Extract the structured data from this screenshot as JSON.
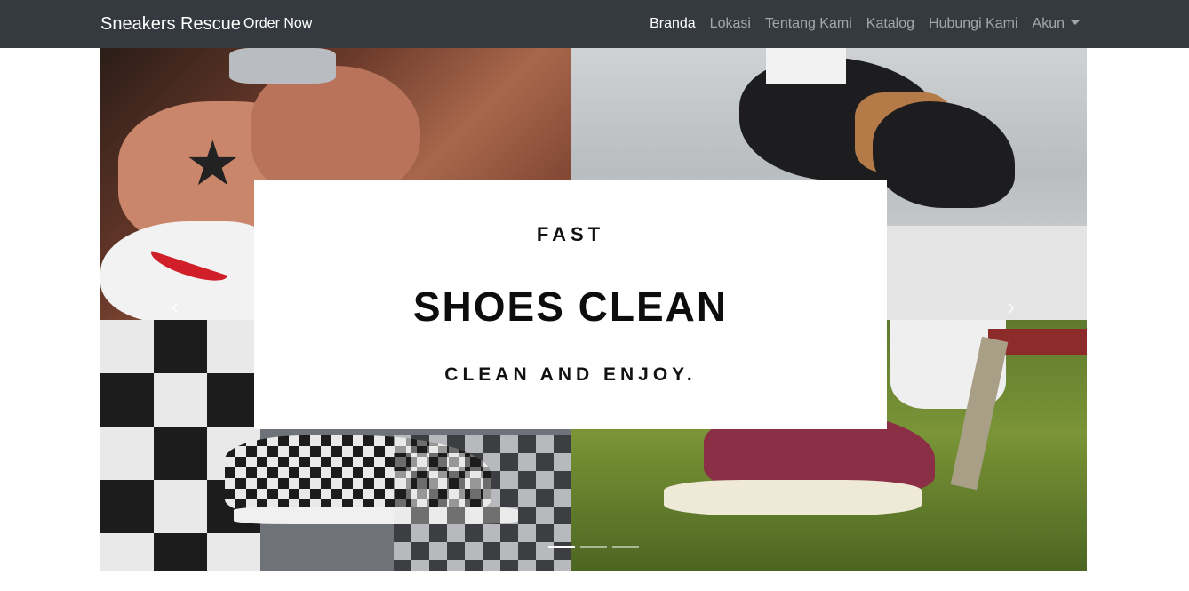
{
  "navbar": {
    "brand": "Sneakers Rescue",
    "order_now": "Order Now",
    "links": [
      {
        "label": "Branda",
        "active": true
      },
      {
        "label": "Lokasi",
        "active": false
      },
      {
        "label": "Tentang Kami",
        "active": false
      },
      {
        "label": "Katalog",
        "active": false
      },
      {
        "label": "Hubungi Kami",
        "active": false
      },
      {
        "label": "Akun",
        "active": false,
        "dropdown": true
      }
    ]
  },
  "carousel": {
    "slide": {
      "line1": "FAST",
      "line2": "SHOES CLEAN",
      "line3": "CLEAN AND ENJOY."
    },
    "prev_icon": "chevron-left-icon",
    "next_icon": "chevron-right-icon",
    "indicator_count": 3,
    "active_indicator": 0
  },
  "colors": {
    "navbar_bg": "#343a40",
    "nav_active": "#ffffff",
    "nav_inactive": "rgba(255,255,255,0.55)"
  }
}
